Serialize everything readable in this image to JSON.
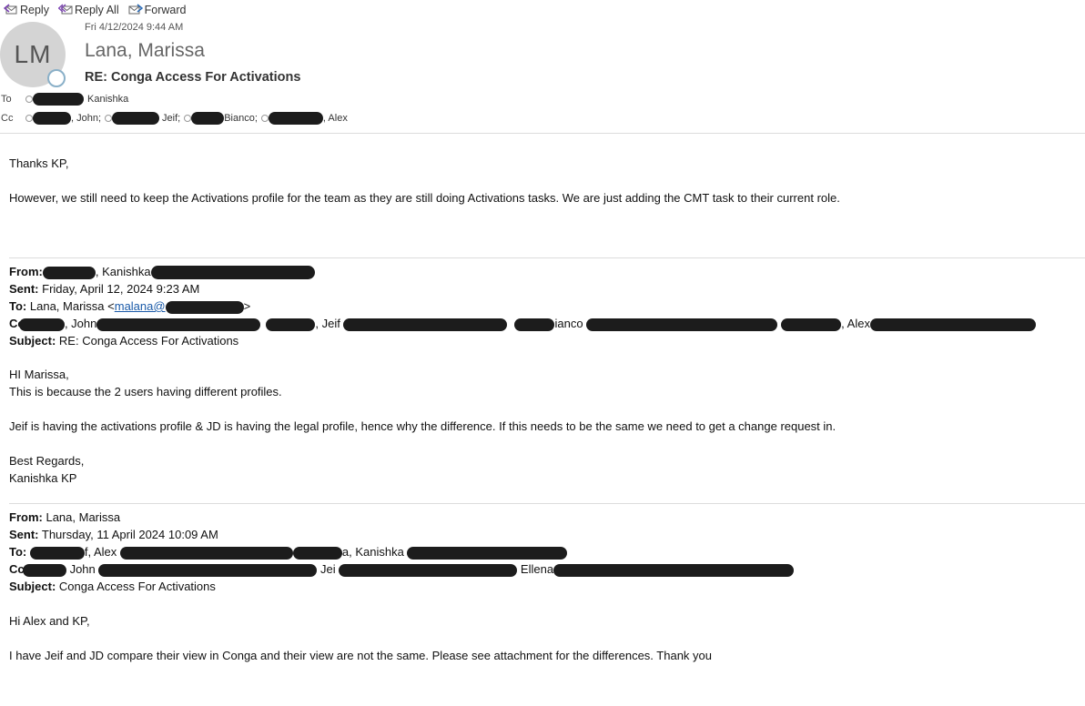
{
  "toolbar": {
    "reply": "Reply",
    "reply_all": "Reply All",
    "forward": "Forward"
  },
  "header": {
    "avatar_initials": "LM",
    "date": "Fri 4/12/2024 9:44 AM",
    "sender": "Lana, Marissa",
    "subject": "RE: Conga Access For Activations",
    "to_label": "To",
    "cc_label": "Cc",
    "to": [
      "Kanishka"
    ],
    "cc": [
      ", John;",
      "Jeif;",
      "Bianco;",
      ", Alex"
    ]
  },
  "body": {
    "greeting": "Thanks KP,",
    "paragraph": "However, we still need to keep the Activations profile for the team as they are still doing Activations tasks. We are just adding the CMT task to their current role."
  },
  "msg1": {
    "from_label": "From:",
    "from_value": ", Kanishka",
    "sent_label": "Sent:",
    "sent_value": "Friday, April 12, 2024 9:23 AM",
    "to_label": "To:",
    "to_value": "Lana, Marissa <",
    "to_email": "malana@",
    "to_close": ">",
    "cc_label": "Cc:",
    "cc_john": ", John",
    "cc_jeif": ", Jeif",
    "cc_bianco": "ianco",
    "cc_alex": ", Alex",
    "subject_label": "Subject:",
    "subject_value": "RE: Conga Access For Activations",
    "lines": [
      "HI Marissa,",
      "This is because the 2 users having different profiles.",
      "Jeif is having the activations profile & JD is having the legal profile, hence why the difference. If this needs to be the same we need to get a change request in.",
      "Best Regards,",
      "Kanishka KP"
    ]
  },
  "msg2": {
    "from_label": "From:",
    "from_value": "Lana, Marissa",
    "sent_label": "Sent:",
    "sent_value": "Thursday, 11 April 2024 10:09 AM",
    "to_label": "To:",
    "to_alex": "f, Alex",
    "to_kanishka": "a, Kanishka",
    "cc_label": "Cc:",
    "cc_john": "John",
    "cc_jeif": "Jei",
    "cc_ellena": "Ellena",
    "subject_label": "Subject:",
    "subject_value": "Conga Access For Activations",
    "lines": [
      "Hi Alex and KP,",
      "I have Jeif and JD compare their view in Conga and their view are not the same. Please see attachment for the differences. Thank you"
    ]
  },
  "colors": {
    "link": "#1a5aa8",
    "redaction": "#1c1c1c",
    "avatar_bg": "#d4d4d4"
  }
}
